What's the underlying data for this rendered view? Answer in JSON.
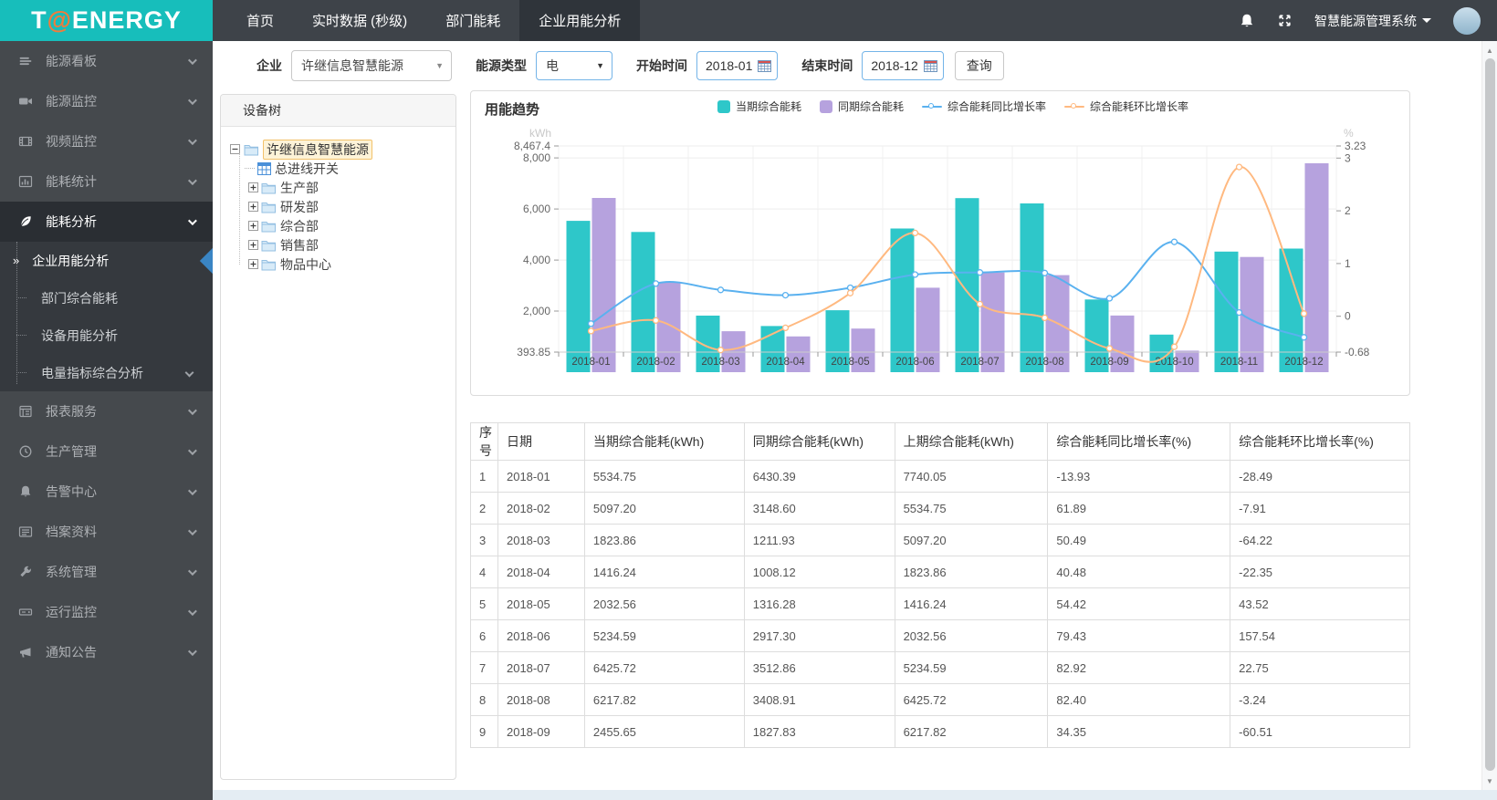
{
  "brand": {
    "logo_prefix": "T",
    "logo_at": "@",
    "logo_suffix": "ENERGY"
  },
  "topbar": {
    "tabs": [
      {
        "label": "首页",
        "active": false
      },
      {
        "label": "实时数据 (秒级)",
        "active": false
      },
      {
        "label": "部门能耗",
        "active": false
      },
      {
        "label": "企业用能分析",
        "active": true
      }
    ],
    "system_title": "智慧能源管理系统"
  },
  "sidebar": {
    "items": [
      {
        "label": "能源看板",
        "icon": "dashboard-icon"
      },
      {
        "label": "能源监控",
        "icon": "camera-icon"
      },
      {
        "label": "视频监控",
        "icon": "film-icon"
      },
      {
        "label": "能耗统计",
        "icon": "stats-icon"
      },
      {
        "label": "能耗分析",
        "icon": "leaf-icon",
        "active": true,
        "open": true,
        "children": [
          {
            "label": "企业用能分析",
            "active": true
          },
          {
            "label": "部门综合能耗"
          },
          {
            "label": "设备用能分析"
          },
          {
            "label": "电量指标综合分析",
            "expandable": true
          }
        ]
      },
      {
        "label": "报表服务",
        "icon": "report-icon"
      },
      {
        "label": "生产管理",
        "icon": "clock-icon"
      },
      {
        "label": "告警中心",
        "icon": "alarm-bell-icon"
      },
      {
        "label": "档案资料",
        "icon": "archive-icon"
      },
      {
        "label": "系统管理",
        "icon": "wrench-icon"
      },
      {
        "label": "运行监控",
        "icon": "server-icon"
      },
      {
        "label": "通知公告",
        "icon": "megaphone-icon"
      }
    ]
  },
  "filters": {
    "company_label": "企业",
    "company_value": "许继信息智慧能源",
    "energy_type_label": "能源类型",
    "energy_type_value": "电",
    "start_label": "开始时间",
    "start_value": "2018-01",
    "end_label": "结束时间",
    "end_value": "2018-12",
    "query_label": "查询"
  },
  "tree": {
    "header": "设备树",
    "root": {
      "label": "许继信息智慧能源",
      "selected": true
    },
    "nodes": [
      {
        "label": "总进线开关",
        "icon": "meter-icon",
        "leaf": true
      },
      {
        "label": "生产部",
        "icon": "folder-icon"
      },
      {
        "label": "研发部",
        "icon": "folder-icon"
      },
      {
        "label": "综合部",
        "icon": "folder-icon"
      },
      {
        "label": "销售部",
        "icon": "folder-icon"
      },
      {
        "label": "物品中心",
        "icon": "folder-icon"
      }
    ]
  },
  "chart_data": {
    "type": "bar+line",
    "title": "用能趋势",
    "legend_position": "top",
    "grid": true,
    "categories": [
      "2018-01",
      "2018-02",
      "2018-03",
      "2018-04",
      "2018-05",
      "2018-06",
      "2018-07",
      "2018-08",
      "2018-09",
      "2018-10",
      "2018-11",
      "2018-12"
    ],
    "series": [
      {
        "name": "当期综合能耗",
        "type": "bar",
        "axis": "left",
        "color": "#2ec7c9",
        "values": [
          5534.75,
          5097.2,
          1823.86,
          1416.24,
          2032.56,
          5234.59,
          6425.72,
          6217.82,
          2455.65,
          1080,
          4330,
          4450
        ]
      },
      {
        "name": "同期综合能耗",
        "type": "bar",
        "axis": "left",
        "color": "#b6a2de",
        "values": [
          6430.39,
          3148.6,
          1211.93,
          1008.12,
          1316.28,
          2917.3,
          3512.86,
          3408.91,
          1827.83,
          450,
          4120,
          7790
        ]
      },
      {
        "name": "综合能耗同比增长率",
        "type": "line",
        "axis": "right",
        "color": "#5ab1ef",
        "values": [
          -0.14,
          0.62,
          0.5,
          0.4,
          0.54,
          0.79,
          0.83,
          0.82,
          0.34,
          1.41,
          0.07,
          -0.4
        ]
      },
      {
        "name": "综合能耗环比增长率",
        "type": "line",
        "axis": "right",
        "color": "#ffb980",
        "values": [
          -0.28,
          -0.08,
          -0.64,
          -0.22,
          0.44,
          1.58,
          0.23,
          -0.03,
          -0.61,
          -0.58,
          2.83,
          0.05
        ]
      }
    ],
    "left_axis": {
      "unit": "kWh",
      "min": 393.85,
      "max": 8467.4,
      "ticks": [
        {
          "label": "8,467.4",
          "value": 8467.4
        },
        {
          "label": "8,000",
          "value": 8000
        },
        {
          "label": "6,000",
          "value": 6000
        },
        {
          "label": "4,000",
          "value": 4000
        },
        {
          "label": "2,000",
          "value": 2000
        },
        {
          "label": "393.85",
          "value": 393.85
        }
      ]
    },
    "right_axis": {
      "unit": "%",
      "min": -0.68,
      "max": 3.23,
      "ticks": [
        {
          "label": "3.23",
          "value": 3.23
        },
        {
          "label": "3",
          "value": 3
        },
        {
          "label": "2",
          "value": 2
        },
        {
          "label": "1",
          "value": 1
        },
        {
          "label": "0",
          "value": 0
        },
        {
          "label": "-0.68",
          "value": -0.68
        }
      ]
    }
  },
  "table": {
    "columns": [
      "序号",
      "日期",
      "当期综合能耗(kWh)",
      "同期综合能耗(kWh)",
      "上期综合能耗(kWh)",
      "综合能耗同比增长率(%)",
      "综合能耗环比增长率(%)"
    ],
    "rows": [
      [
        "1",
        "2018-01",
        "5534.75",
        "6430.39",
        "7740.05",
        "-13.93",
        "-28.49"
      ],
      [
        "2",
        "2018-02",
        "5097.20",
        "3148.60",
        "5534.75",
        "61.89",
        "-7.91"
      ],
      [
        "3",
        "2018-03",
        "1823.86",
        "1211.93",
        "5097.20",
        "50.49",
        "-64.22"
      ],
      [
        "4",
        "2018-04",
        "1416.24",
        "1008.12",
        "1823.86",
        "40.48",
        "-22.35"
      ],
      [
        "5",
        "2018-05",
        "2032.56",
        "1316.28",
        "1416.24",
        "54.42",
        "43.52"
      ],
      [
        "6",
        "2018-06",
        "5234.59",
        "2917.30",
        "2032.56",
        "79.43",
        "157.54"
      ],
      [
        "7",
        "2018-07",
        "6425.72",
        "3512.86",
        "5234.59",
        "82.92",
        "22.75"
      ],
      [
        "8",
        "2018-08",
        "6217.82",
        "3408.91",
        "6425.72",
        "82.40",
        "-3.24"
      ],
      [
        "9",
        "2018-09",
        "2455.65",
        "1827.83",
        "6217.82",
        "34.35",
        "-60.51"
      ]
    ]
  },
  "colors": {
    "brand_teal": "#17bebb",
    "logo_at_orange": "#f07c3c",
    "topbar_bg": "#3e4349",
    "topbar_active_tab": "#2f343a",
    "sidebar_bg": "#45494d",
    "sidebar_active_bg": "#2a2e33",
    "submenu_bg": "#35393e",
    "submenu_marker_blue": "#3a85c4",
    "accent_blue_border": "#74b4e8",
    "bar_current": "#2ec7c9",
    "bar_same_period": "#b6a2de",
    "line_yoy": "#5ab1ef",
    "line_mom": "#ffb980",
    "tree_selected_bg": "#fdf3d8",
    "tree_selected_border": "#f3c26b"
  }
}
